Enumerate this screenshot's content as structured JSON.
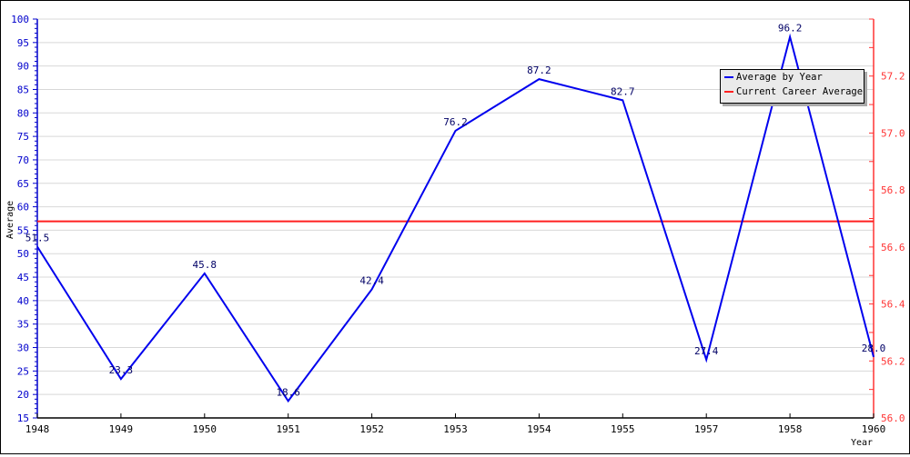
{
  "chart_data": {
    "type": "line",
    "title": "",
    "xlabel": "Year",
    "ylabel": "Average",
    "categories": [
      "1948",
      "1949",
      "1950",
      "1951",
      "1952",
      "1953",
      "1954",
      "1955",
      "1957",
      "1958",
      "1960"
    ],
    "series": [
      {
        "name": "Average by Year",
        "color": "#0000ee",
        "axis": "left",
        "values": [
          51.5,
          23.3,
          45.8,
          18.6,
          42.4,
          76.2,
          87.2,
          82.7,
          27.4,
          96.2,
          28.0
        ],
        "labels": [
          "51.5",
          "23.3",
          "45.8",
          "18.6",
          "42.4",
          "76.2",
          "87.2",
          "82.7",
          "27.4",
          "96.2",
          "28.0"
        ]
      },
      {
        "name": "Current Career Average",
        "color": "#ff2020",
        "axis": "right",
        "value": 56.69
      }
    ],
    "left_axis": {
      "range": [
        15,
        100
      ],
      "ticks": [
        "15",
        "20",
        "25",
        "30",
        "35",
        "40",
        "45",
        "50",
        "55",
        "60",
        "65",
        "70",
        "75",
        "80",
        "85",
        "90",
        "95",
        "100"
      ],
      "color": "#0000cc"
    },
    "right_axis": {
      "range": [
        56.0,
        57.4
      ],
      "ticks": [
        "56.0",
        "56.2",
        "56.4",
        "56.6",
        "56.8",
        "57.0",
        "57.2"
      ],
      "color": "#ff3333"
    },
    "grid": true,
    "legend_position": "top-right"
  }
}
